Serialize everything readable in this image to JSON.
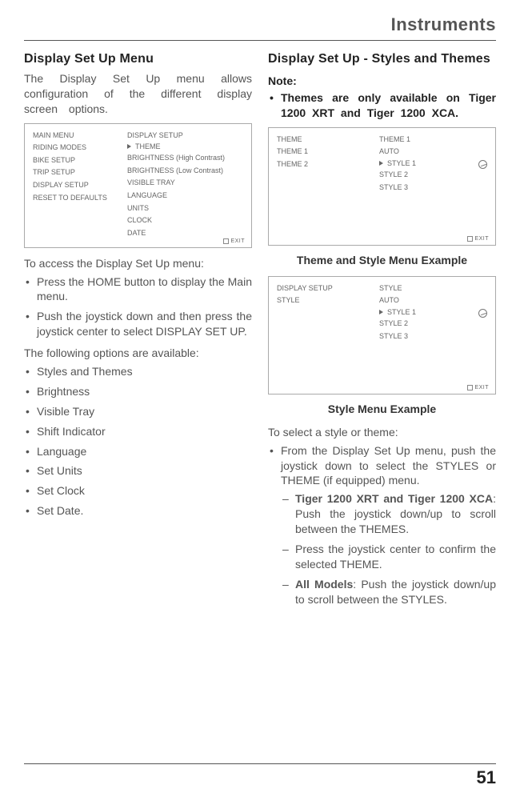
{
  "header": {
    "chapter": "Instruments"
  },
  "page_number": "51",
  "left": {
    "heading": "Display Set Up Menu",
    "intro": "The Display Set Up menu allows configuration of the different display screen options.",
    "screen1": {
      "left_col": [
        "MAIN MENU",
        "RIDING MODES",
        "BIKE SETUP",
        "TRIP SETUP",
        "DISPLAY SETUP",
        "RESET TO DEFAULTS"
      ],
      "right_col": [
        "DISPLAY SETUP",
        "THEME",
        "BRIGHTNESS (High Contrast)",
        "BRIGHTNESS (Low Contrast)",
        "VISIBLE TRAY",
        "LANGUAGE",
        "UNITS",
        "CLOCK",
        "DATE"
      ],
      "selected_index": 1,
      "exit": "EXIT"
    },
    "access_lead": "To access the Display Set Up menu:",
    "access_steps": [
      "Press the HOME button to display the Main menu.",
      "Push the joystick down and then press the joystick center to select DISPLAY SET UP."
    ],
    "options_lead": "The following options are available:",
    "options": [
      "Styles and Themes",
      "Brightness",
      "Visible Tray",
      "Shift Indicator",
      "Language",
      "Set Units",
      "Set Clock",
      "Set Date."
    ]
  },
  "right": {
    "heading": "Display Set Up - Styles and Themes",
    "note_label": "Note:",
    "note_text": "Themes are only available on Tiger 1200 XRT and Tiger 1200 XCA.",
    "screen_theme": {
      "left_col": [
        "THEME",
        "THEME 1",
        "THEME 2"
      ],
      "right_col": [
        "THEME 1",
        "AUTO",
        "STYLE 1",
        "STYLE 2",
        "STYLE 3"
      ],
      "selected_index": 2,
      "exit": "EXIT"
    },
    "caption_theme": "Theme and Style Menu Example",
    "screen_style": {
      "left_col": [
        "DISPLAY SETUP",
        "STYLE"
      ],
      "right_col": [
        "STYLE",
        "AUTO",
        "STYLE 1",
        "STYLE 2",
        "STYLE 3"
      ],
      "selected_index": 2,
      "exit": "EXIT"
    },
    "caption_style": "Style Menu Example",
    "select_lead": "To select a style or theme:",
    "select_step": "From the Display Set Up menu, push the joystick down to select the STYLES or THEME (if equipped) menu.",
    "sub_bold_a_models": "Tiger 1200 XRT and Tiger 1200 XCA",
    "sub_a_rest": ": Push the joystick down/up to scroll between the THEMES.",
    "sub_b": "Press the joystick center to confirm the selected THEME.",
    "sub_bold_c_models": "All Models",
    "sub_c_rest": ": Push the joystick down/up to scroll between the STYLES."
  }
}
